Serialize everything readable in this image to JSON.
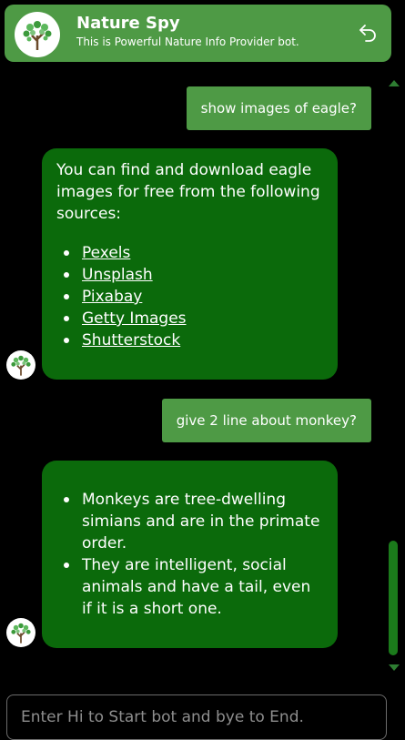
{
  "header": {
    "title": "Nature Spy",
    "subtitle": "This is Powerful Nature Info Provider bot."
  },
  "messages": {
    "user1": "show images of eagle?",
    "bot1": {
      "intro": "You can find and download eagle images for free from the following sources:",
      "links": [
        "Pexels",
        "Unsplash",
        "Pixabay",
        "Getty Images",
        "Shutterstock"
      ]
    },
    "user2": "give 2 line about monkey?",
    "bot2": {
      "bullets": [
        "Monkeys are tree-dwelling simians and are in the primate order.",
        "They are intelligent, social animals and have a tail, even if it is a short one."
      ]
    }
  },
  "input": {
    "placeholder": "Enter Hi to Start bot and bye to End."
  },
  "icons": {
    "logo": "tree-icon",
    "back": "undo-arrow-icon"
  },
  "colors": {
    "header": "#4e9a45",
    "user_bubble": "#4e9a45",
    "bot_bubble": "#0b6a0b",
    "background": "#000000"
  }
}
